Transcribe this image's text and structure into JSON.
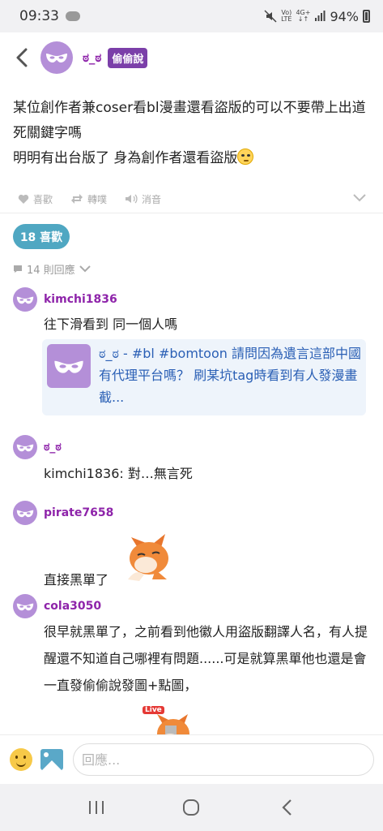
{
  "status": {
    "time": "09:33",
    "battery": "94%",
    "lte_top": "Vo)",
    "lte_bottom": "LTE",
    "signal_top": "4G+",
    "signal_bottom": "↓↑"
  },
  "header": {
    "username": "ಠ_ಠ",
    "board_tag": "偷偷說"
  },
  "post": {
    "line1": "某位創作者兼coser看bl漫畫還看盜版的可以不要帶上出道死關鍵字嗎",
    "line2": "明明有出台版了 身為創作者還看盜版"
  },
  "actions": {
    "like": "喜歡",
    "repost": "轉噗",
    "mute": "消音"
  },
  "likes_pill": "18 喜歡",
  "reply_count": "14 則回應",
  "comments": [
    {
      "name": "kimchi1836",
      "text": "往下滑看到 同一個人嗎"
    },
    {
      "name": "ಠ_ಠ",
      "text": "kimchi1836: 對…無言死"
    },
    {
      "name": "pirate7658",
      "text": "直接黑單了"
    },
    {
      "name": "cola3050",
      "text": "很早就黑單了，之前看到他徽人用盜版翻譯人名，有人提醒還不知道自己哪裡有問題......可是就算黑單他也還是會一直發偷偷說發圖+點圖，"
    }
  ],
  "quote": {
    "text": "ಠ_ಠ - #bl #bomtoon 請問因為遺言這部中國有代理平台嗎？ 刷某坑tag時看到有人發漫畫截..."
  },
  "sticker_badge": "Live",
  "reply_input": {
    "placeholder": "回應..."
  },
  "colors": {
    "accent_purple": "#8e24aa",
    "tag_purple": "#7b3fa9",
    "pill_blue": "#4fa7c2",
    "link_blue": "#2a5fb5"
  }
}
